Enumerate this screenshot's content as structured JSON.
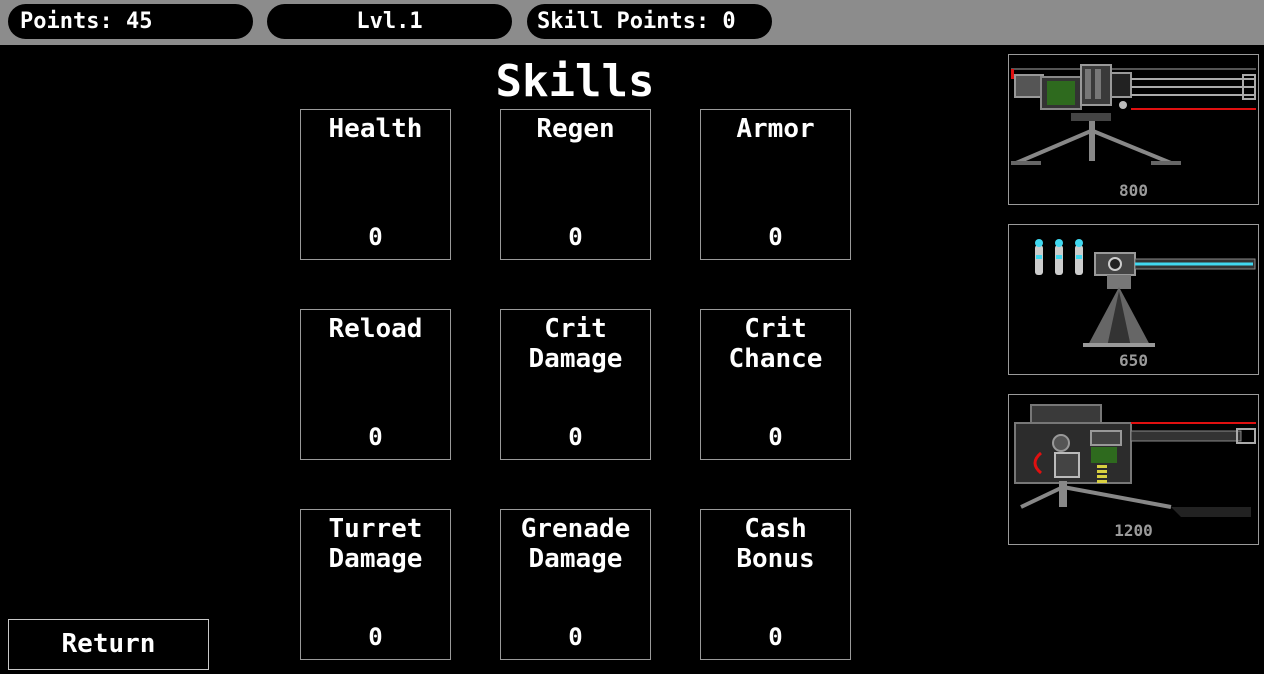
{
  "header": {
    "points_label": "Points: 45",
    "level_label": "Lvl.1",
    "skill_points_label": "Skill Points: 0"
  },
  "title": "Skills",
  "skills": [
    {
      "name": "Health",
      "value": "0"
    },
    {
      "name": "Regen",
      "value": "0"
    },
    {
      "name": "Armor",
      "value": "0"
    },
    {
      "name": "Reload",
      "value": "0"
    },
    {
      "name": "Crit\nDamage",
      "value": "0"
    },
    {
      "name": "Crit\nChance",
      "value": "0"
    },
    {
      "name": "Turret\nDamage",
      "value": "0"
    },
    {
      "name": "Grenade\nDamage",
      "value": "0"
    },
    {
      "name": "Cash\nBonus",
      "value": "0"
    }
  ],
  "turrets": [
    {
      "icon": "minigun-turret-icon",
      "price": "800"
    },
    {
      "icon": "laser-turret-icon",
      "price": "650"
    },
    {
      "icon": "heavy-turret-icon",
      "price": "1200"
    }
  ],
  "return_label": "Return",
  "colors": {
    "topbar": "#8c8c8c",
    "background": "#000000",
    "border": "#9a9a9a",
    "price_text": "#9a9a9a",
    "laser_red": "#e01010",
    "laser_cyan": "#40d8f0",
    "armor_green": "#2e6a1e"
  }
}
